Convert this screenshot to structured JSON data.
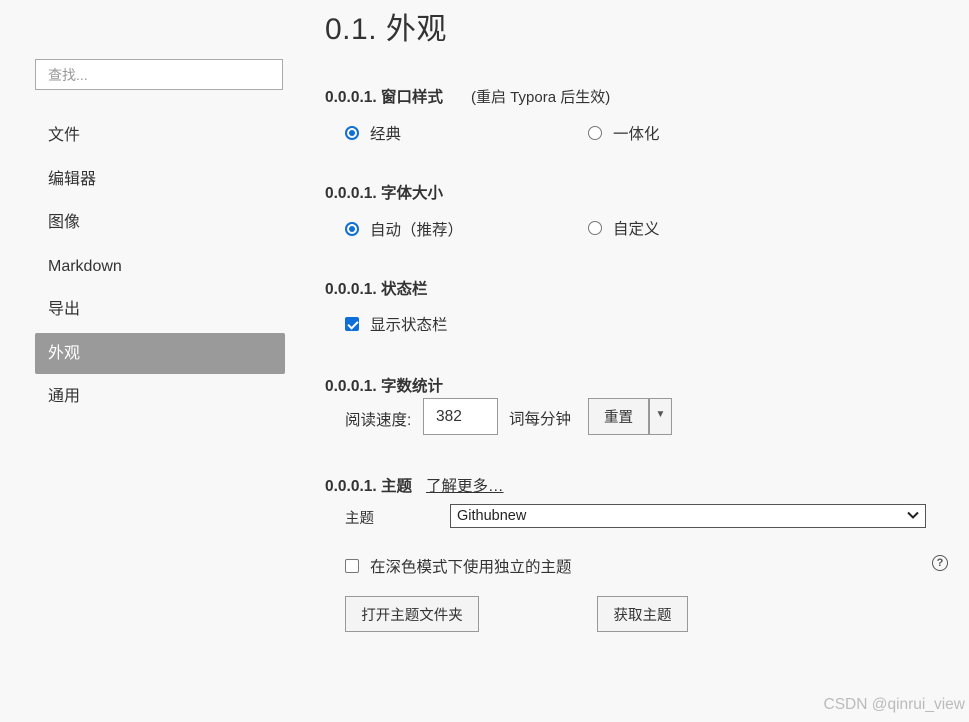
{
  "search": {
    "placeholder": "查找..."
  },
  "sidebar": {
    "items": [
      {
        "label": "文件"
      },
      {
        "label": "编辑器"
      },
      {
        "label": "图像"
      },
      {
        "label": "Markdown"
      },
      {
        "label": "导出"
      },
      {
        "label": "外观",
        "active": true
      },
      {
        "label": "通用"
      }
    ]
  },
  "page": {
    "title": "0.1.  外观"
  },
  "window_style": {
    "title": "0.0.0.1.  窗口样式",
    "note": "(重启 Typora 后生效)",
    "options": [
      {
        "label": "经典",
        "checked": true
      },
      {
        "label": "一体化",
        "checked": false
      }
    ]
  },
  "font_size": {
    "title": "0.0.0.1.  字体大小",
    "options": [
      {
        "label": "自动（推荐）",
        "checked": true
      },
      {
        "label": "自定义",
        "checked": false
      }
    ]
  },
  "status_bar": {
    "title": "0.0.0.1.  状态栏",
    "checkbox": {
      "label": "显示状态栏",
      "checked": true
    }
  },
  "word_count": {
    "title": "0.0.0.1.  字数统计",
    "speed_label": "阅读速度:",
    "speed_value": "382",
    "unit_label": "词每分钟",
    "reset_label": "重置"
  },
  "theme": {
    "title": "0.0.0.1.  主题",
    "learn_more": "了解更多…",
    "theme_label": "主题",
    "selected": "Githubnew",
    "dark_checkbox": {
      "label": "在深色模式下使用独立的主题",
      "checked": false
    },
    "help_icon": "?",
    "open_folder_label": "打开主题文件夹",
    "get_themes_label": "获取主题"
  },
  "watermark": "CSDN @qinrui_view",
  "colors": {
    "accent": "#0f6fd8",
    "active_bg": "#9a9a9a",
    "background": "#f8f8f8"
  }
}
